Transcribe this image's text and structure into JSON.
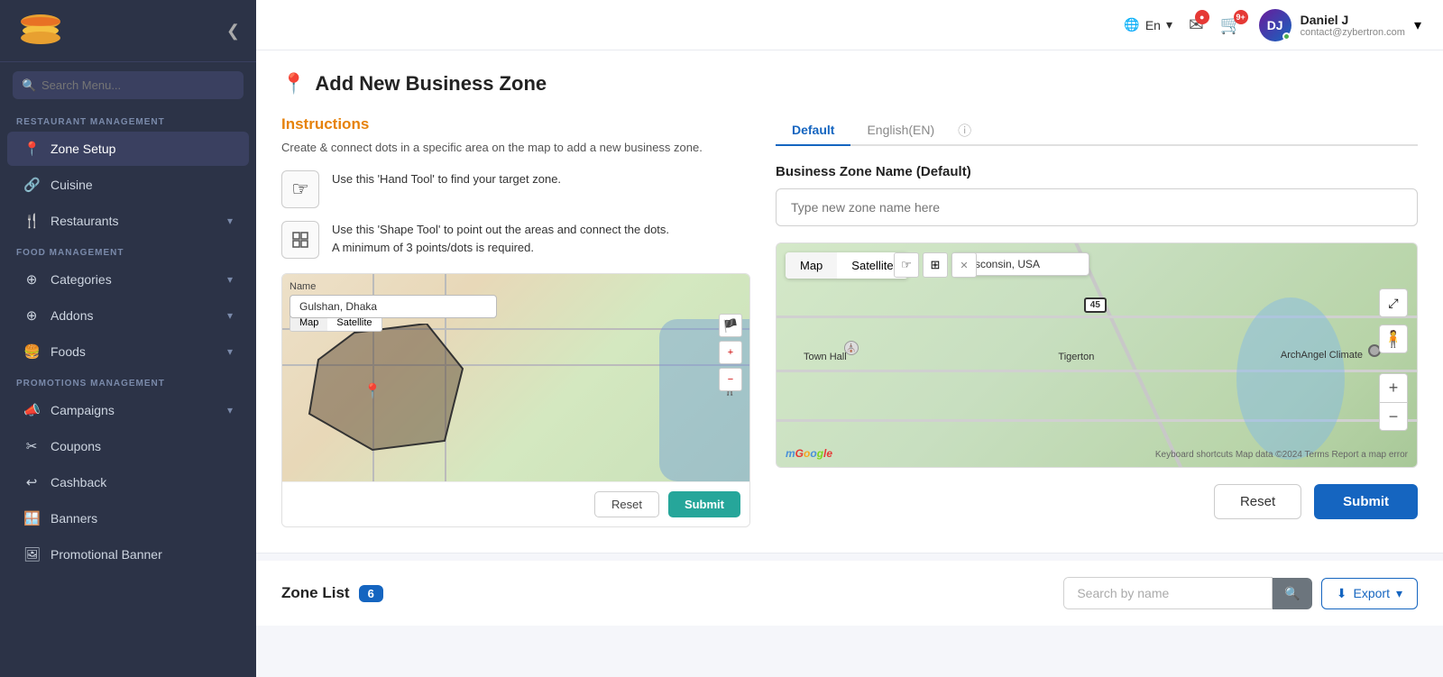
{
  "sidebar": {
    "logo_alt": "Restaurant Logo",
    "collapse_icon": "❮",
    "search_placeholder": "Search Menu...",
    "section_restaurant": "RESTAURANT MANAGEMENT",
    "section_food": "FOOD MANAGEMENT",
    "section_promotions": "PROMOTIONS MANAGEMENT",
    "items": [
      {
        "id": "zone-setup",
        "label": "Zone Setup",
        "icon": "📍",
        "active": true,
        "has_arrow": false
      },
      {
        "id": "cuisine",
        "label": "Cuisine",
        "icon": "🔗",
        "active": false,
        "has_arrow": false
      },
      {
        "id": "restaurants",
        "label": "Restaurants",
        "icon": "🍴",
        "active": false,
        "has_arrow": true
      },
      {
        "id": "categories",
        "label": "Categories",
        "icon": "⊕",
        "active": false,
        "has_arrow": true
      },
      {
        "id": "addons",
        "label": "Addons",
        "icon": "⊕",
        "active": false,
        "has_arrow": true
      },
      {
        "id": "foods",
        "label": "Foods",
        "icon": "🍔",
        "active": false,
        "has_arrow": true
      },
      {
        "id": "campaigns",
        "label": "Campaigns",
        "icon": "📣",
        "active": false,
        "has_arrow": true
      },
      {
        "id": "coupons",
        "label": "Coupons",
        "icon": "✂",
        "active": false,
        "has_arrow": false
      },
      {
        "id": "cashback",
        "label": "Cashback",
        "icon": "↩",
        "active": false,
        "has_arrow": false
      },
      {
        "id": "banners",
        "label": "Banners",
        "icon": "🪟",
        "active": false,
        "has_arrow": false
      },
      {
        "id": "promotional-banner",
        "label": "Promotional Banner",
        "icon": "🖼",
        "active": false,
        "has_arrow": false
      }
    ]
  },
  "topbar": {
    "lang": "En",
    "lang_icon": "🌐",
    "mail_icon": "✉",
    "cart_icon": "🛒",
    "cart_badge": "9+",
    "mail_badge": "",
    "user_name": "Daniel J",
    "user_email": "contact@zybertron.com",
    "user_initials": "DJ",
    "dropdown_icon": "▾"
  },
  "page": {
    "title": "Add New Business Zone",
    "pin_icon": "📍"
  },
  "instructions": {
    "title": "Instructions",
    "desc": "Create & connect dots in a specific area on the map to add a new business zone.",
    "steps": [
      {
        "icon": "☞",
        "text": "Use this 'Hand Tool' to find your target zone."
      },
      {
        "icon": "⊞",
        "text": "Use this 'Shape Tool' to point out the areas and connect the dots.\nA minimum of 3 points/dots is required."
      }
    ],
    "map_name_label": "Name",
    "map_name_value": "Gulshan, Dhaka",
    "map_tab1": "Map",
    "map_tab2": "Satellite",
    "reset_btn": "Reset",
    "submit_btn": "Submit"
  },
  "zone_form": {
    "tab_default": "Default",
    "tab_english": "English(EN)",
    "tab_info_icon": "ⓘ",
    "name_label": "Business Zone Name (Default)",
    "name_placeholder": "Type new zone name here",
    "map_tab1": "Map",
    "map_tab2": "Satellite",
    "map_search_value": "Wisconsin, USA",
    "map_label1": "Town Hall",
    "map_label2": "Tigerton",
    "map_label3": "ArchAngel Climate",
    "map_route_number": "45",
    "google_logo": "Google",
    "map_copyright": "Keyboard shortcuts   Map data ©2024   Terms   Report a map error",
    "reset_btn": "Reset",
    "submit_btn": "Submit"
  },
  "zone_list": {
    "title": "Zone List",
    "count": "6",
    "search_placeholder": "Search by name",
    "export_btn": "Export",
    "search_icon": "🔍",
    "export_icon": "⬇"
  }
}
